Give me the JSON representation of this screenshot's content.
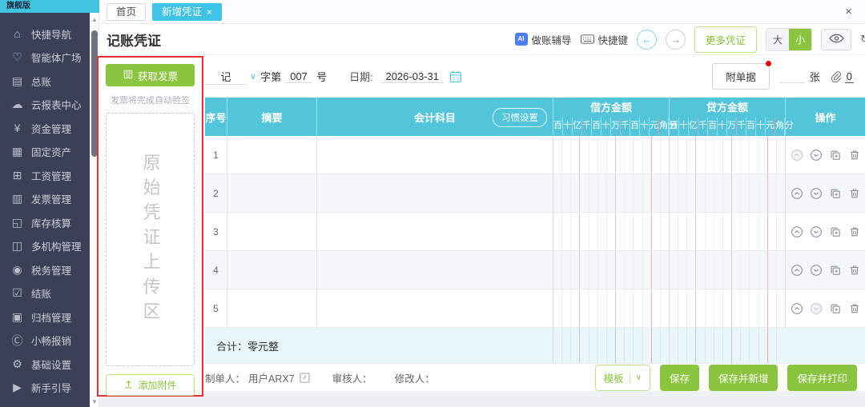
{
  "app": {
    "edition_badge": "旗舰版",
    "close_label": "×"
  },
  "sidebar": {
    "items": [
      {
        "icon": "home-icon",
        "label": "快捷导航"
      },
      {
        "icon": "heart-icon",
        "label": "智能体广场"
      },
      {
        "icon": "ledger-icon",
        "label": "总账"
      },
      {
        "icon": "cloud-report-icon",
        "label": "云报表中心"
      },
      {
        "icon": "funds-icon",
        "label": "资金管理"
      },
      {
        "icon": "fixed-assets-icon",
        "label": "固定资产"
      },
      {
        "icon": "payroll-icon",
        "label": "工资管理"
      },
      {
        "icon": "invoice-icon",
        "label": "发票管理"
      },
      {
        "icon": "inventory-icon",
        "label": "库存核算"
      },
      {
        "icon": "org-icon",
        "label": "多机构管理"
      },
      {
        "icon": "tax-icon",
        "label": "税务管理"
      },
      {
        "icon": "closing-icon",
        "label": "结账"
      },
      {
        "icon": "archive-icon",
        "label": "归档管理"
      },
      {
        "icon": "reimburse-icon",
        "label": "小畅报销"
      },
      {
        "icon": "settings-icon",
        "label": "基础设置"
      },
      {
        "icon": "guide-icon",
        "label": "新手引导"
      }
    ]
  },
  "tabs": [
    {
      "label": "首页",
      "active": false
    },
    {
      "label": "新增凭证",
      "active": true,
      "closable": true
    }
  ],
  "header": {
    "title": "记账凭证",
    "tools": {
      "ai_coach": "做账辅导",
      "hotkeys": "快捷键",
      "more_vouchers": "更多凭证",
      "size_large": "大",
      "size_small": "小",
      "refresh": "刷新"
    }
  },
  "invoice_panel": {
    "get_invoice": "获取发票",
    "auto_verify_hint": "发票将完成自动验签",
    "upload_zone": "原始凭证上传区",
    "add_attachment": "添加附件"
  },
  "voucher": {
    "type": "记",
    "zi_di": "字第",
    "number": "007",
    "hao": "号",
    "date_label": "日期:",
    "date": "2026-03-31",
    "attach_doc": "附单据",
    "zhang": "张",
    "attach_count": "0"
  },
  "table": {
    "col_seq": "序号",
    "col_summary": "摘要",
    "col_account": "会计科目",
    "habit_button": "习惯设置",
    "col_debit": "借方金额",
    "col_credit": "贷方金额",
    "col_actions": "操作",
    "digits": [
      "百",
      "十",
      "亿",
      "千",
      "百",
      "十",
      "万",
      "千",
      "百",
      "十",
      "元",
      "角",
      "分"
    ],
    "rows": [
      "1",
      "2",
      "3",
      "4",
      "5"
    ],
    "total_label": "合计：零元整"
  },
  "footer": {
    "preparer_label": "制单人：",
    "preparer": "用户ARX7",
    "reviewer_label": "审核人：",
    "modifier_label": "修改人：",
    "template_button": "模板",
    "save": "保存",
    "save_new": "保存并新增",
    "save_print": "保存并打印"
  },
  "colors": {
    "accent_green": "#8bc53f",
    "table_header_cyan": "#52c5db",
    "active_tab_cyan": "#3fc3e6",
    "sidebar_bg": "#3b4056",
    "panel_border_red": "#e83333",
    "edition_badge_cyan": "#41c4e0"
  }
}
